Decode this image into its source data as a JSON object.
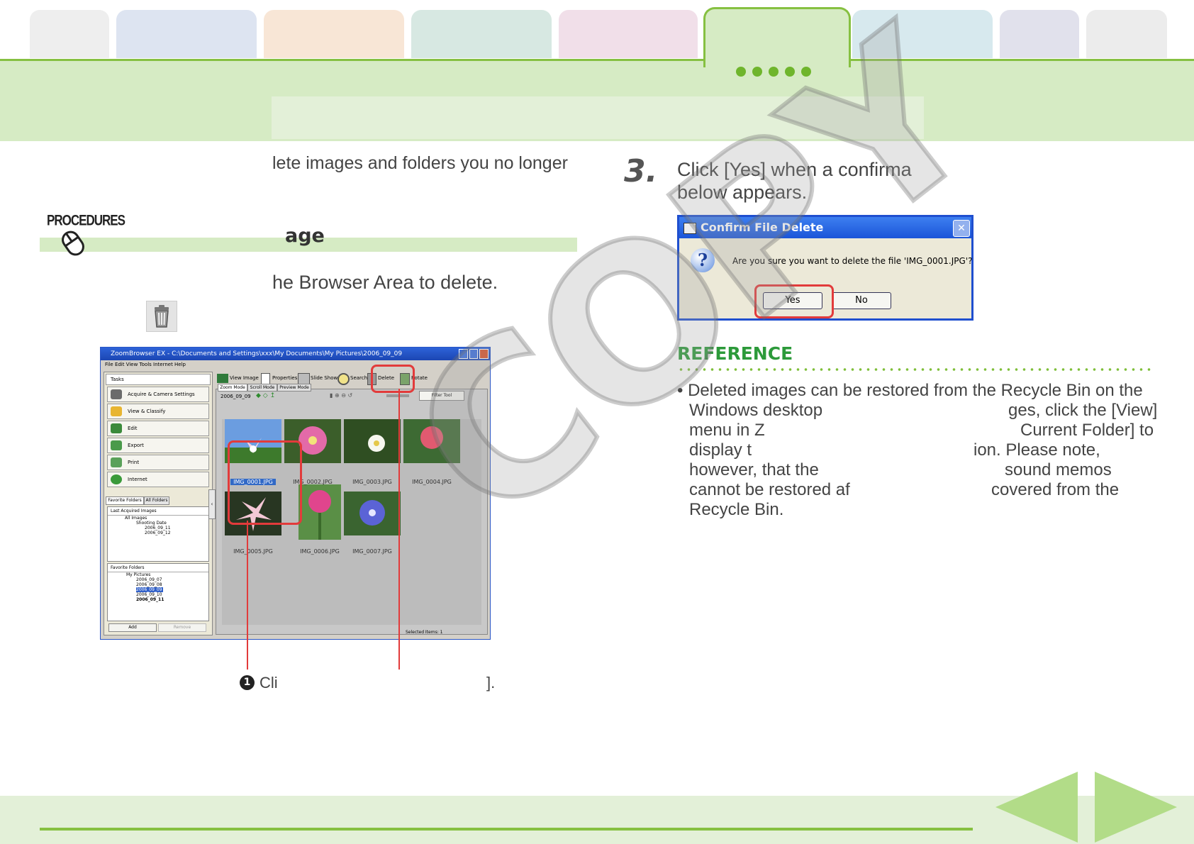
{
  "header": {
    "tab_colors": [
      "#eeeeee",
      "#dde4f1",
      "#f8e6d6",
      "#d7e8e2",
      "#f1dfe9",
      "#d6ebc4",
      "#d7e9ee",
      "#e1e1ec",
      "#ececec"
    ],
    "accent": "#86c041"
  },
  "intro": {
    "text": "lete images and folders you no longer"
  },
  "procedures": {
    "label": "PROCEDURES",
    "icon": "mouse-icon",
    "heading": "age"
  },
  "steps": {
    "step_text": "he Browser Area to delete.",
    "trash_icon": "trash-icon",
    "step3_number": "3.",
    "step3_line1": "Click [Yes] when a confirma",
    "step3_line2": "below appears."
  },
  "zoombrowser": {
    "title": "ZoomBrowser EX  -  C:\\Documents and Settings\\xxx\\My Documents\\My Pictures\\2006_09_09",
    "menu": "File   Edit   View   Tools   Internet   Help",
    "tasks_label": "Tasks",
    "side_buttons": [
      "Acquire & Camera Settings",
      "View & Classify",
      "Edit",
      "Export",
      "Print",
      "Internet"
    ],
    "tabs": [
      "Favorite Folders",
      "All Folders"
    ],
    "last_acquired": "Last Acquired Images",
    "tree1": [
      "All Images",
      "Shooting Date",
      "2006_09_11",
      "2006_09_12"
    ],
    "favorite_folders": "Favorite Folders",
    "tree2": [
      "My Pictures",
      "2006_09_07",
      "2006_09_08",
      "2006_09_09",
      "2006_09_10",
      "2006_09_11"
    ],
    "add": "Add",
    "remove": "Remove",
    "toolbar": [
      "View Image",
      "Properties",
      "Slide Show",
      "Search",
      "Delete",
      "Rotate"
    ],
    "modes": [
      "Zoom Mode",
      "Scroll Mode",
      "Preview Mode"
    ],
    "folder": "2006_09_09",
    "filter": "Filter Tool",
    "thumbs": [
      "IMG_0001.JPG",
      "IMG_0002.JPG",
      "IMG_0003.JPG",
      "IMG_0004.JPG",
      "IMG_0005.JPG",
      "IMG_0006.JPG",
      "IMG_0007.JPG"
    ],
    "status": "Selected Items: 1"
  },
  "callout": {
    "num": "1",
    "text_start": "Cli",
    "text_end": "]."
  },
  "dialog": {
    "title": "Confirm File Delete",
    "message": "Are you sure you want to delete the file 'IMG_0001.JPG'?",
    "yes": "Yes",
    "no": "No",
    "icon": "question-icon",
    "close": "close-icon"
  },
  "reference": {
    "heading": "REFERENCE",
    "line1": "• Deleted images can be restored from the Recycle Bin on the",
    "line2a": "Windows desktop",
    "line2b": "ges, click the [View]",
    "line3a": "menu in Z",
    "line3b": "Current Folder] to",
    "line4a": "display t",
    "line4b": "ion. Please note,",
    "line5a": "however, that the",
    "line5b": "sound memos",
    "line6a": "cannot be restored af",
    "line6b": "covered from the",
    "line7": "Recycle Bin."
  },
  "watermark": "COPY",
  "nav": {
    "prev": "prev-arrow-icon",
    "next": "next-arrow-icon"
  }
}
